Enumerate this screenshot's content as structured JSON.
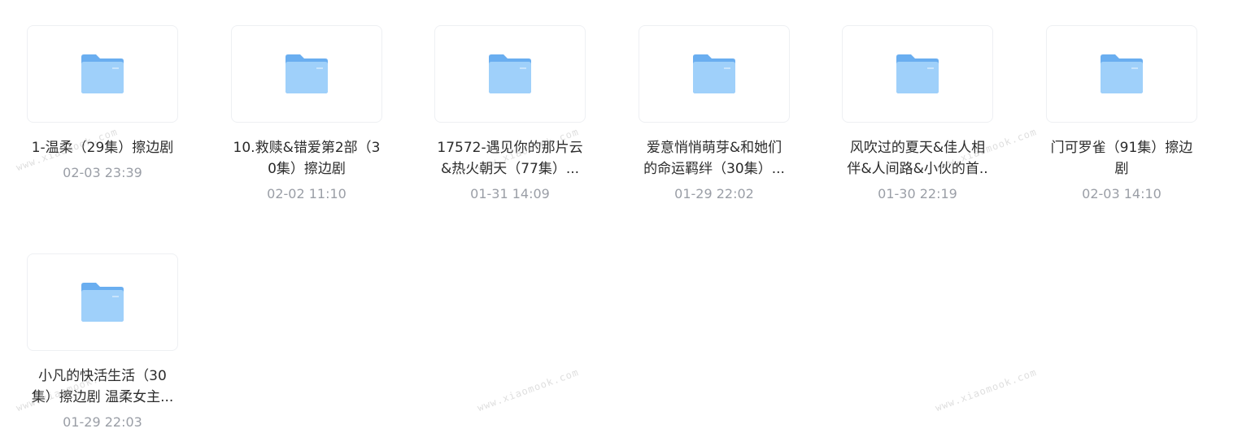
{
  "folders": [
    {
      "name": "1-温柔（29集）擦边剧",
      "date": "02-03 23:39",
      "icon": "folder-icon"
    },
    {
      "name": "10.救赎&错爱第2部（30集）擦边剧",
      "date": "02-02 11:10",
      "icon": "folder-icon"
    },
    {
      "name": "17572-遇见你的那片云&热火朝天（77集）...",
      "date": "01-31 14:09",
      "icon": "folder-icon"
    },
    {
      "name": "爱意悄悄萌芽&和她们的命运羁绊（30集）...",
      "date": "01-29 22:02",
      "icon": "folder-icon"
    },
    {
      "name": "风吹过的夏天&佳人相伴&人间路&小伙的首..",
      "date": "01-30 22:19",
      "icon": "folder-icon"
    },
    {
      "name": "门可罗雀（91集）擦边剧",
      "date": "02-03 14:10",
      "icon": "folder-icon"
    },
    {
      "name": "小凡的快活生活（30集）擦边剧 温柔女主...",
      "date": "01-29 22:03",
      "icon": "folder-icon"
    }
  ],
  "watermark": "www.xiaomook.com",
  "colors": {
    "folder_front": "#8ec5f7",
    "folder_back": "#6aaef0",
    "name_text": "#2b2b2b",
    "date_text": "#9a9ea6",
    "thumb_border": "#eef0f3"
  }
}
